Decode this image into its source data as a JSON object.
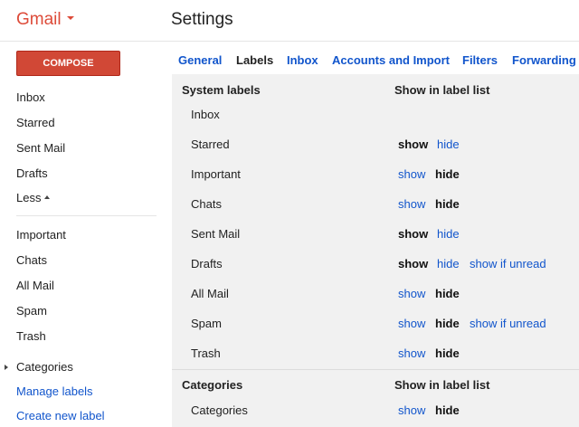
{
  "brand": {
    "name": "Gmail"
  },
  "page": {
    "title": "Settings"
  },
  "sidebar": {
    "compose_label": "COMPOSE",
    "items": [
      "Inbox",
      "Starred",
      "Sent Mail",
      "Drafts"
    ],
    "less_label": "Less",
    "more_items": [
      "Important",
      "Chats",
      "All Mail",
      "Spam",
      "Trash"
    ],
    "categories_label": "Categories",
    "manage_labels": "Manage labels",
    "create_label": "Create new label"
  },
  "tabs": [
    "General",
    "Labels",
    "Inbox",
    "Accounts and Import",
    "Filters",
    "Forwarding a"
  ],
  "active_tab": "Labels",
  "system_labels": {
    "header": "System labels",
    "show_header": "Show in label list",
    "rows": [
      {
        "name": "Inbox"
      },
      {
        "name": "Starred",
        "show": "show",
        "hide": "hide",
        "selected": "show"
      },
      {
        "name": "Important",
        "show": "show",
        "hide": "hide",
        "selected": "hide"
      },
      {
        "name": "Chats",
        "show": "show",
        "hide": "hide",
        "selected": "hide"
      },
      {
        "name": "Sent Mail",
        "show": "show",
        "hide": "hide",
        "selected": "show"
      },
      {
        "name": "Drafts",
        "show": "show",
        "hide": "hide",
        "unread": "show if unread",
        "selected": "show"
      },
      {
        "name": "All Mail",
        "show": "show",
        "hide": "hide",
        "selected": "hide"
      },
      {
        "name": "Spam",
        "show": "show",
        "hide": "hide",
        "unread": "show if unread",
        "selected": "hide"
      },
      {
        "name": "Trash",
        "show": "show",
        "hide": "hide",
        "selected": "hide"
      }
    ]
  },
  "categories_section": {
    "header": "Categories",
    "show_header": "Show in label list",
    "rows": [
      {
        "name": "Categories",
        "show": "show",
        "hide": "hide",
        "selected": "hide"
      }
    ]
  },
  "colors": {
    "brand_red": "#dd4b39",
    "compose_red": "#d14836",
    "link_blue": "#1155cc",
    "panel_bg": "#f1f1f1"
  }
}
